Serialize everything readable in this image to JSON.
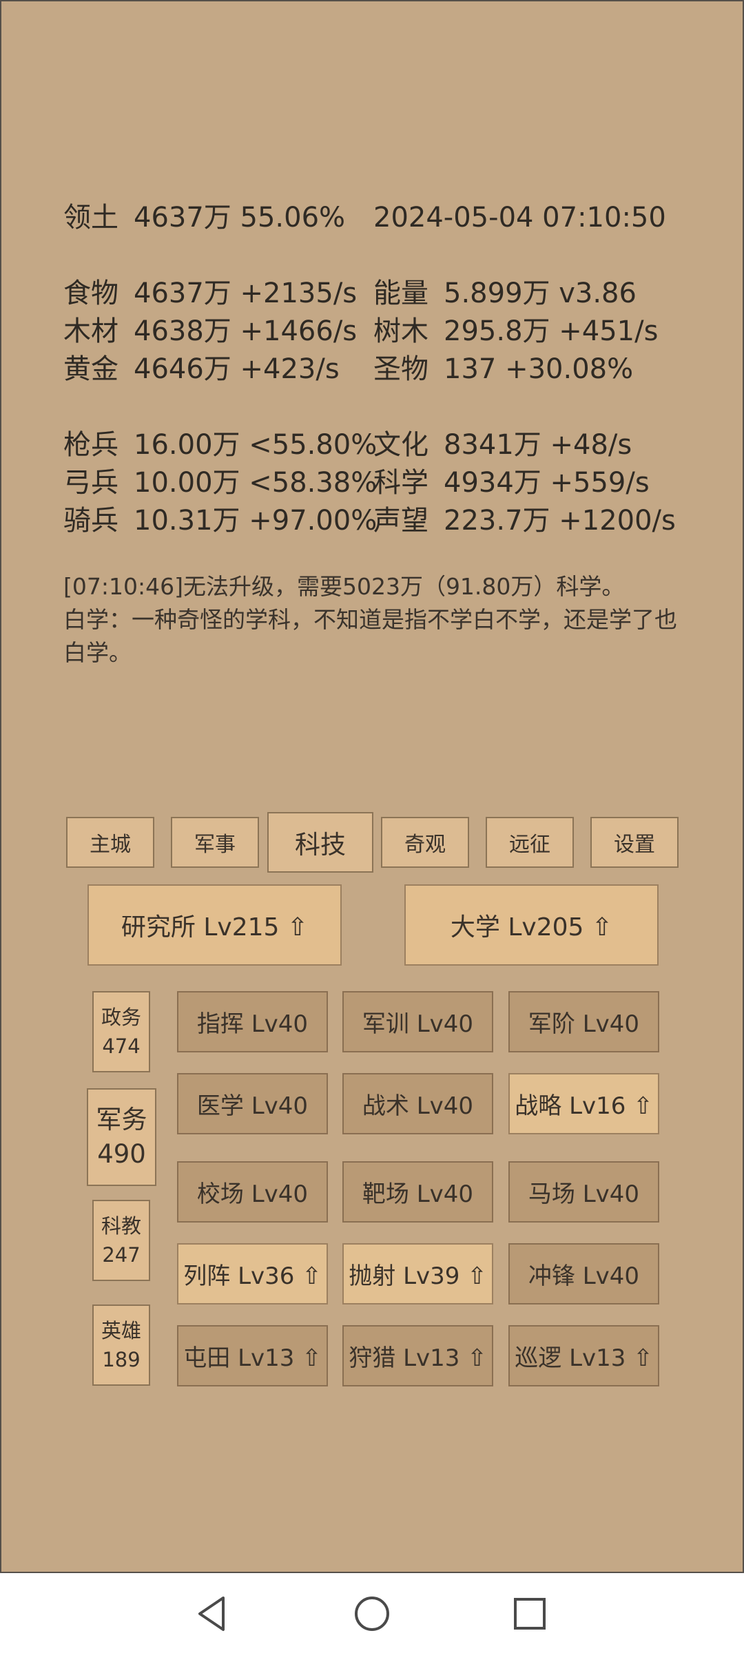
{
  "header": {
    "territory": {
      "label": "领土",
      "value": "4637万  55.06%"
    },
    "datetime": "2024-05-04 07:10:50"
  },
  "resources_left": [
    {
      "label": "食物",
      "value": "4637万 +2135/s"
    },
    {
      "label": "木材",
      "value": "4638万 +1466/s"
    },
    {
      "label": "黄金",
      "value": "4646万 +423/s"
    }
  ],
  "resources_right": [
    {
      "label": "能量",
      "value": "5.899万  v3.86"
    },
    {
      "label": "树木",
      "value": "295.8万 +451/s"
    },
    {
      "label": "圣物",
      "value": "137 +30.08%"
    }
  ],
  "troops_left": [
    {
      "label": "枪兵",
      "value": "16.00万 <55.80%"
    },
    {
      "label": "弓兵",
      "value": "10.00万 <58.38%"
    },
    {
      "label": "骑兵",
      "value": "10.31万 +97.00%"
    }
  ],
  "troops_right": [
    {
      "label": "文化",
      "value": "8341万 +48/s"
    },
    {
      "label": "科学",
      "value": "4934万 +559/s"
    },
    {
      "label": "声望",
      "value": "223.7万 +1200/s"
    }
  ],
  "log": {
    "line1": "[07:10:46]无法升级，需要5023万（91.80万）科学。",
    "line2": "白学：一种奇怪的学科，不知道是指不学白不学，还是学了也白学。"
  },
  "tabs": [
    "主城",
    "军事",
    "科技",
    "奇观",
    "远征",
    "设置"
  ],
  "buildings": [
    "研究所 Lv215 ⇧",
    "大学 Lv205 ⇧"
  ],
  "categories": [
    {
      "name": "政务",
      "count": "474"
    },
    {
      "name": "军务",
      "count": "490"
    },
    {
      "name": "科教",
      "count": "247"
    },
    {
      "name": "英雄",
      "count": "189"
    }
  ],
  "techs": [
    [
      "指挥 Lv40",
      "军训 Lv40",
      "军阶 Lv40"
    ],
    [
      "医学 Lv40",
      "战术 Lv40",
      "战略 Lv16 ⇧"
    ],
    [
      "校场 Lv40",
      "靶场 Lv40",
      "马场 Lv40"
    ],
    [
      "列阵 Lv36 ⇧",
      "抛射 Lv39 ⇧",
      "冲锋 Lv40"
    ],
    [
      "屯田 Lv13 ⇧",
      "狩猎 Lv13 ⇧",
      "巡逻 Lv13 ⇧"
    ]
  ],
  "navbar": {
    "icons": [
      "back-icon",
      "home-icon",
      "recents-icon"
    ]
  }
}
